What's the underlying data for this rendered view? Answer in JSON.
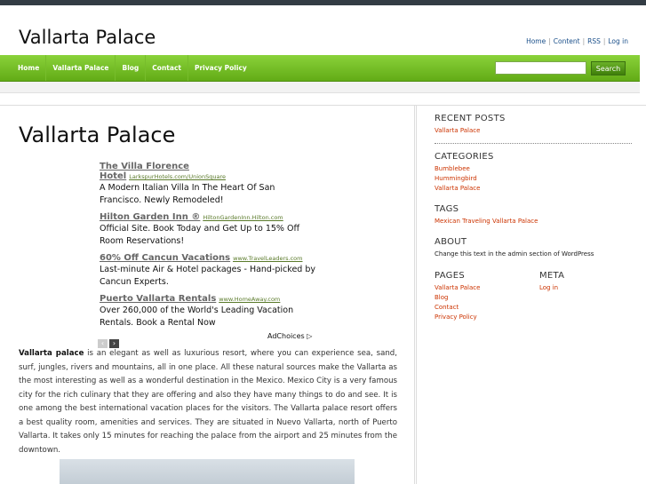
{
  "site": {
    "title": "Vallarta Palace",
    "toplinks": [
      "Home",
      "Content",
      "RSS",
      "Log in"
    ]
  },
  "nav": {
    "items": [
      "Home",
      "Vallarta Palace",
      "Blog",
      "Contact",
      "Privacy Policy"
    ],
    "search_button": "Search"
  },
  "page": {
    "title": "Vallarta Palace",
    "ads": [
      {
        "title": "The Villa Florence Hotel",
        "url": "LarkspurHotels.com/UnionSquare",
        "body": "A Modern Italian Villa In The Heart Of San Francisco. Newly Remodeled!"
      },
      {
        "title": "Hilton Garden Inn ®",
        "url": "HiltonGardenInn.Hilton.com",
        "body": "Official Site. Book Today and Get Up to 15% Off Room Reservations!"
      },
      {
        "title": "60% Off Cancun Vacations",
        "url": "www.TravelLeaders.com",
        "body": "Last-minute Air & Hotel packages - Hand-picked by Cancun Experts."
      },
      {
        "title": "Puerto Vallarta Rentals",
        "url": "www.HomeAway.com",
        "body": "Over 260,000 of the World's Leading Vacation Rentals. Book a Rental Now"
      }
    ],
    "adchoices": "AdChoices ▷",
    "ad_prev": "‹",
    "ad_next": "›",
    "body_bold": "Vallarta palace",
    "body_rest": " is an elegant as well as luxurious resort, where you can experience sea, sand, surf, jungles, rivers and mountains, all in one place. All these natural sources make the Vallarta as the most interesting as well as a wonderful destination in the Mexico. Mexico City is a very famous city for the rich culinary that they are offering and also they have many things to do and see. It is one among the best international vacation places for the visitors. The Vallarta palace resort offers a best quality room, amenities and services. They are situated in Nuevo Vallarta, north of Puerto Vallarta. It takes only 15 minutes for reaching the palace from the airport and 25 minutes from the downtown."
  },
  "sidebar": {
    "recent_posts": {
      "title": "RECENT POSTS",
      "items": [
        "Vallarta Palace"
      ]
    },
    "categories": {
      "title": "CATEGORIES",
      "items": [
        "Bumblebee",
        "Hummingbird",
        "Vallarta Palace"
      ]
    },
    "tags": {
      "title": "TAGS",
      "text": "Mexican Traveling Vallarta Palace"
    },
    "about": {
      "title": "ABOUT",
      "text": "Change this text in the admin section of WordPress"
    },
    "pages": {
      "title": "PAGES",
      "items": [
        "Vallarta Palace",
        "Blog",
        "Contact",
        "Privacy Policy"
      ]
    },
    "meta": {
      "title": "META",
      "items": [
        "Log in"
      ]
    }
  }
}
